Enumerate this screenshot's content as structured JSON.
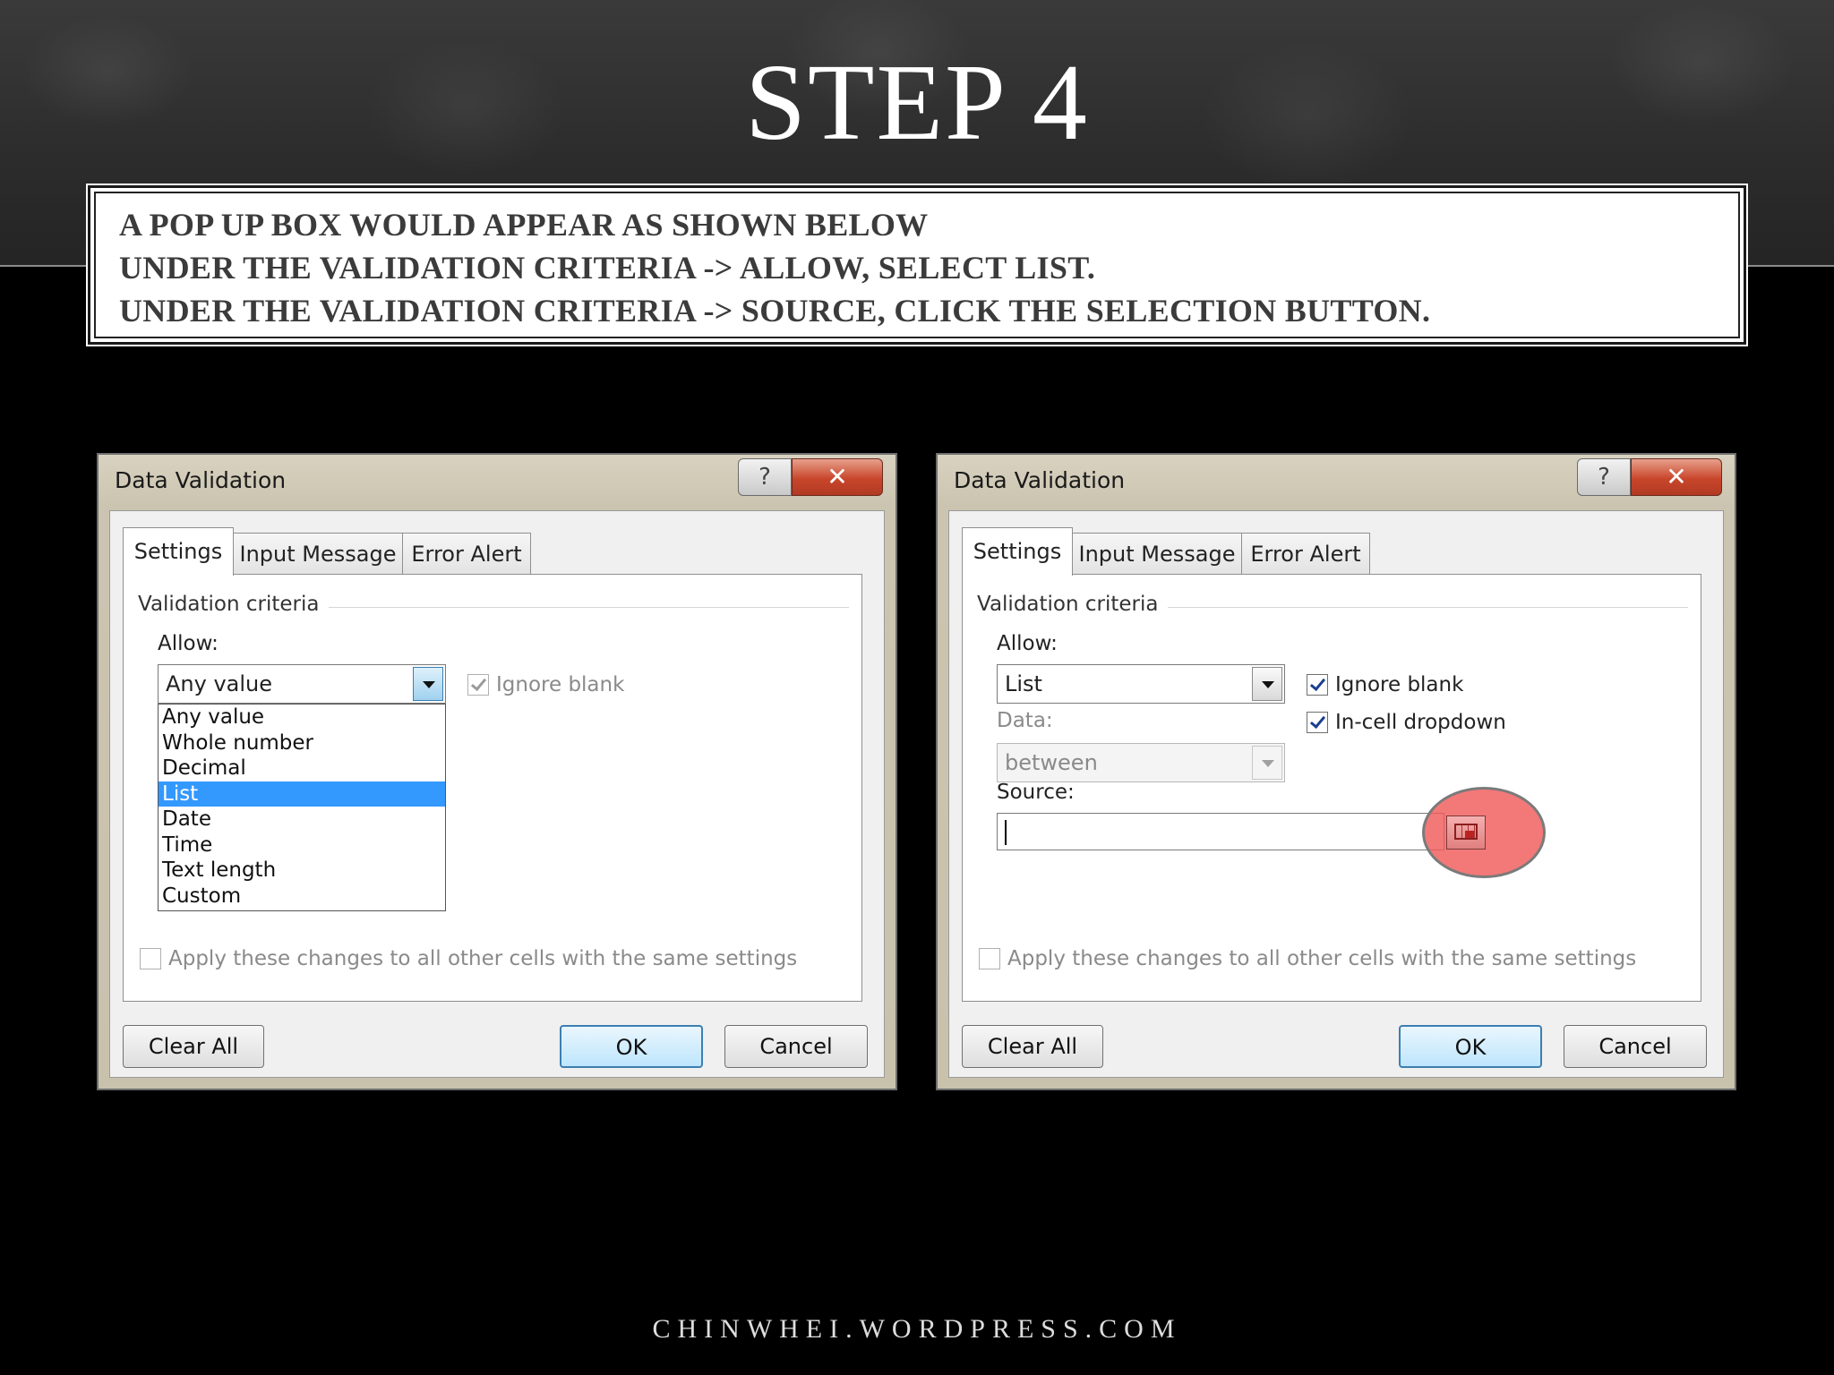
{
  "slide": {
    "title": "STEP 4",
    "instructions": [
      "A POP UP BOX WOULD APPEAR AS SHOWN BELOW",
      "UNDER THE VALIDATION CRITERIA -> ALLOW, SELECT LIST.",
      "UNDER THE VALIDATION CRITERIA -> SOURCE, CLICK THE SELECTION BUTTON."
    ],
    "footer": "CHINWHEI.WORDPRESS.COM"
  },
  "dialog1": {
    "title": "Data Validation",
    "help": "?",
    "close": "✕",
    "tabs": [
      "Settings",
      "Input Message",
      "Error Alert"
    ],
    "group": "Validation criteria",
    "allow_label": "Allow:",
    "allow_value": "Any value",
    "ignore_blank": "Ignore blank",
    "options": [
      "Any value",
      "Whole number",
      "Decimal",
      "List",
      "Date",
      "Time",
      "Text length",
      "Custom"
    ],
    "selected_option": "List",
    "apply_all": "Apply these changes to all other cells with the same settings",
    "clear_all": "Clear All",
    "ok": "OK",
    "cancel": "Cancel"
  },
  "dialog2": {
    "title": "Data Validation",
    "help": "?",
    "close": "✕",
    "tabs": [
      "Settings",
      "Input Message",
      "Error Alert"
    ],
    "group": "Validation criteria",
    "allow_label": "Allow:",
    "allow_value": "List",
    "ignore_blank": "Ignore blank",
    "incell_dropdown": "In-cell dropdown",
    "data_label": "Data:",
    "data_value": "between",
    "source_label": "Source:",
    "source_value": "",
    "apply_all": "Apply these changes to all other cells with the same settings",
    "clear_all": "Clear All",
    "ok": "OK",
    "cancel": "Cancel"
  },
  "icons": {
    "selection_button": "range-selector-icon",
    "highlight_color": "#f05a5a"
  }
}
